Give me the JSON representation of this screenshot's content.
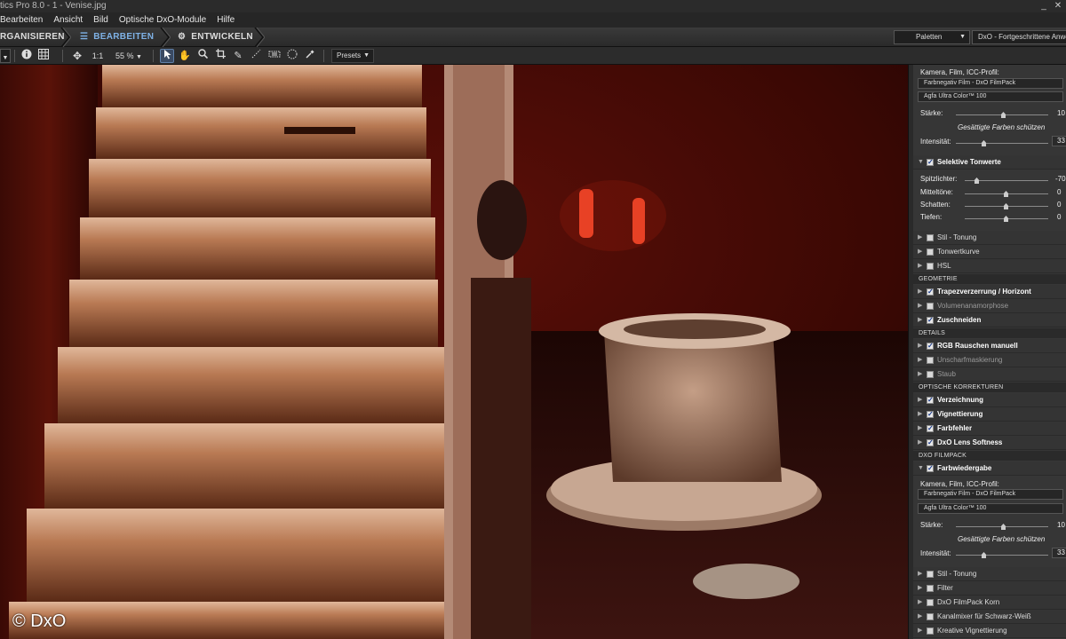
{
  "window": {
    "title": "tics Pro 8.0 - 1 - Venise.jpg",
    "close_glyph": "✕"
  },
  "menu": [
    "Bearbeiten",
    "Ansicht",
    "Bild",
    "Optische DxO-Module",
    "Hilfe"
  ],
  "modes": {
    "organize": "RGANISIEREN",
    "edit": "BEARBEITEN",
    "develop": "ENTWICKELN"
  },
  "palettes": {
    "label": "Paletten"
  },
  "workspace": {
    "label": "DxO - Fortgeschrittene Anwe"
  },
  "toolbar": {
    "ratio": "1:1",
    "zoom": "55 %",
    "presets": "Presets"
  },
  "canvas": {
    "copyright": "© DxO"
  },
  "panel": {
    "top": {
      "camera_label": "Kamera, Film, ICC-Profil:",
      "camera_value": "Farbnegativ Film - DxO FilmPack",
      "film_value": "Agfa Ultra Color™ 100",
      "strength_label": "Stärke:",
      "strength_value": "10",
      "protect": "Gesättigte Farben schützen",
      "intensity_label": "Intensität:",
      "intensity_value": "33"
    },
    "selective": {
      "title": "Selektive Tonwerte",
      "rows": [
        {
          "label": "Spitzlichter:",
          "value": "-70"
        },
        {
          "label": "Mitteltöne:",
          "value": "0"
        },
        {
          "label": "Schatten:",
          "value": "0"
        },
        {
          "label": "Tiefen:",
          "value": "0"
        }
      ]
    },
    "rows1": [
      "Stil - Tonung",
      "Tonwertkurve",
      "HSL"
    ],
    "sect_geometry": "GEOMETRIE",
    "geometry": [
      "Trapezverzerrung / Horizont",
      "Volumenanamorphose",
      "Zuschneiden"
    ],
    "sect_details": "DETAILS",
    "details": [
      "RGB Rauschen manuell",
      "Unscharfmaskierung",
      "Staub"
    ],
    "sect_optical": "OPTISCHE KORREKTUREN",
    "optical": [
      "Verzeichnung",
      "Vignettierung",
      "Farbfehler",
      "DxO Lens Softness"
    ],
    "sect_filmpack": "DXO FILMPACK",
    "farb": {
      "title": "Farbwiedergabe",
      "camera_label": "Kamera, Film, ICC-Profil:",
      "camera_value": "Farbnegativ Film - DxO FilmPack",
      "film_value": "Agfa Ultra Color™ 100",
      "strength_label": "Stärke:",
      "strength_value": "10",
      "protect": "Gesättigte Farben schützen",
      "intensity_label": "Intensität:",
      "intensity_value": "33"
    },
    "filmpack_rows": [
      "Stil - Tonung",
      "Filter",
      "DxO FilmPack Korn",
      "Kanalmixer für Schwarz-Weiß",
      "Kreative Vignettierung"
    ]
  }
}
